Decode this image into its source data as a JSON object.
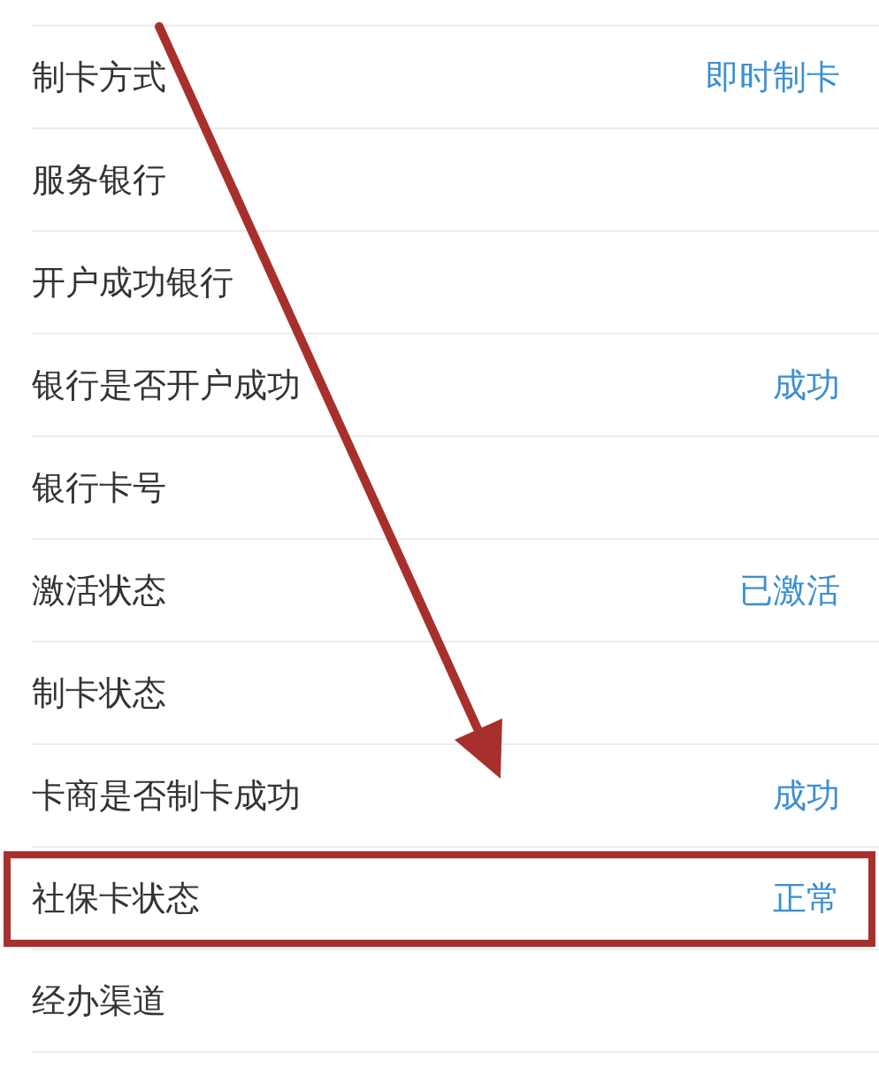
{
  "rows": [
    {
      "label": "制卡方式",
      "value": "即时制卡",
      "highlighted": false
    },
    {
      "label": "服务银行",
      "highlighted": false
    },
    {
      "label": "开户成功银行",
      "highlighted": false
    },
    {
      "label": "银行是否开户成功",
      "value": "成功",
      "highlighted": false
    },
    {
      "label": "银行卡号",
      "highlighted": false
    },
    {
      "label": "激活状态",
      "value": "已激活",
      "highlighted": false
    },
    {
      "label": "制卡状态",
      "highlighted": false
    },
    {
      "label": "卡商是否制卡成功",
      "value": "成功",
      "highlighted": false
    },
    {
      "label": "社保卡状态",
      "value": "正常",
      "highlighted": true
    },
    {
      "label": "经办渠道",
      "highlighted": false
    }
  ]
}
